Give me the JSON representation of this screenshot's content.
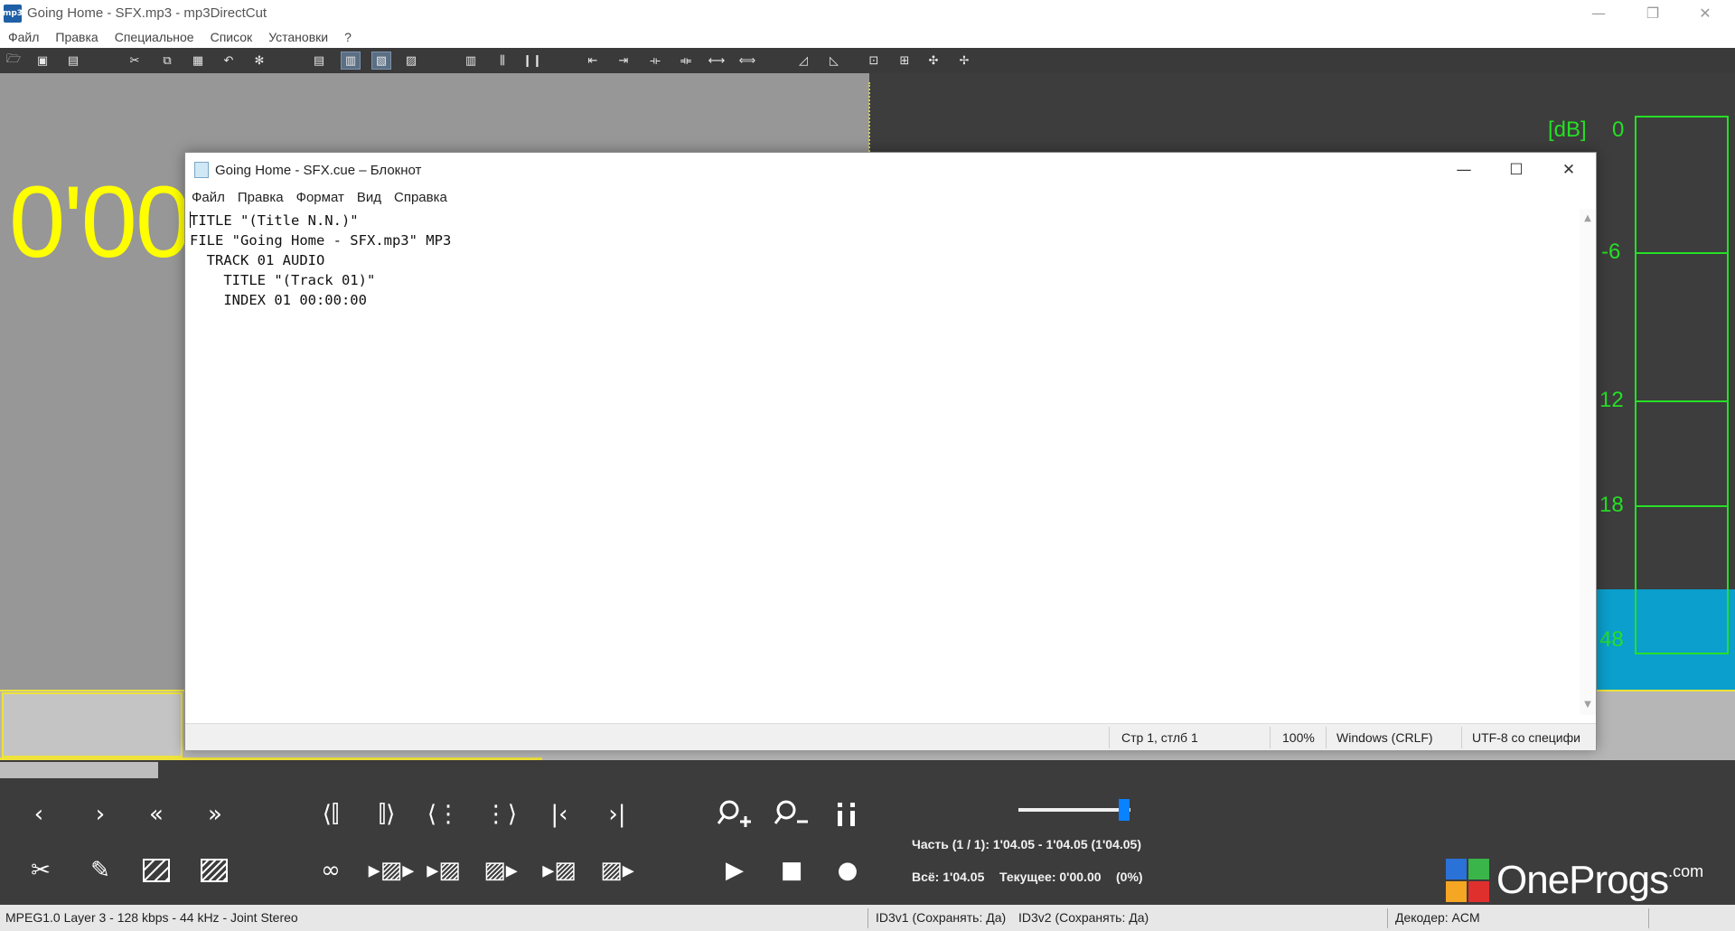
{
  "app": {
    "title": "Going Home - SFX.mp3 - mp3DirectCut",
    "icon_text": "mp3",
    "window_controls": {
      "minimize": "—",
      "restore": "❐",
      "close": "✕"
    }
  },
  "menu": [
    "Файл",
    "Правка",
    "Специальное",
    "Список",
    "Установки",
    "?"
  ],
  "toolbar_icons": [
    "open-icon",
    "save-icon",
    "save-selection-icon",
    "cut-icon",
    "copy-icon",
    "paste-icon",
    "undo-icon",
    "settings-icon",
    "doc-icon",
    "doc-active-icon",
    "doc-edit-icon",
    "doc-info-icon",
    "barcode-icon",
    "bars-icon",
    "pause-bars-icon",
    "split-left-icon",
    "split-icon",
    "marker-left-icon",
    "marker-right-icon",
    "marker-both-icon",
    "marker-both-alt-icon",
    "fade-in-icon",
    "fade-out-icon",
    "normalize-icon",
    "normalize-alt-icon",
    "expand-icon",
    "expand-alt-icon"
  ],
  "waveform": {
    "time_display": "0'00",
    "accent": "#ffff00"
  },
  "vu_meter": {
    "unit": "[dB]",
    "labels": [
      "0",
      "-6",
      "12",
      "18",
      "48"
    ],
    "level_color": "#0a9fcc",
    "line_color": "#25e025"
  },
  "volume": {
    "level": 0.94
  },
  "segment_info": "Часть (1 / 1): 1'04.05 - 1'04.05 (1'04.05)",
  "totals": {
    "total": "Всё: 1'04.05",
    "current": "Текущее: 0'00.00",
    "percent": "(0%)"
  },
  "logo": {
    "text": "OneProgs",
    "suffix": ".com"
  },
  "status": {
    "format": "MPEG1.0 Layer 3 - 128 kbps - 44 kHz - Joint Stereo",
    "id3v1": "ID3v1 (Сохранять: Да)",
    "id3v2": "ID3v2 (Сохранять: Да)",
    "decoder": "Декодер: ACM"
  },
  "notepad": {
    "title": "Going Home - SFX.cue – Блокнот",
    "menu": [
      "Файл",
      "Правка",
      "Формат",
      "Вид",
      "Справка"
    ],
    "content": "TITLE \"(Title N.N.)\"\nFILE \"Going Home - SFX.mp3\" MP3\n  TRACK 01 AUDIO\n    TITLE \"(Track 01)\"\n    INDEX 01 00:00:00",
    "status": {
      "position": "Стр 1, стлб 1",
      "zoom": "100%",
      "line_ending": "Windows (CRLF)",
      "encoding": "UTF-8 со специфи"
    },
    "window_controls": {
      "minimize": "—",
      "maximize": "☐",
      "close": "✕"
    }
  }
}
